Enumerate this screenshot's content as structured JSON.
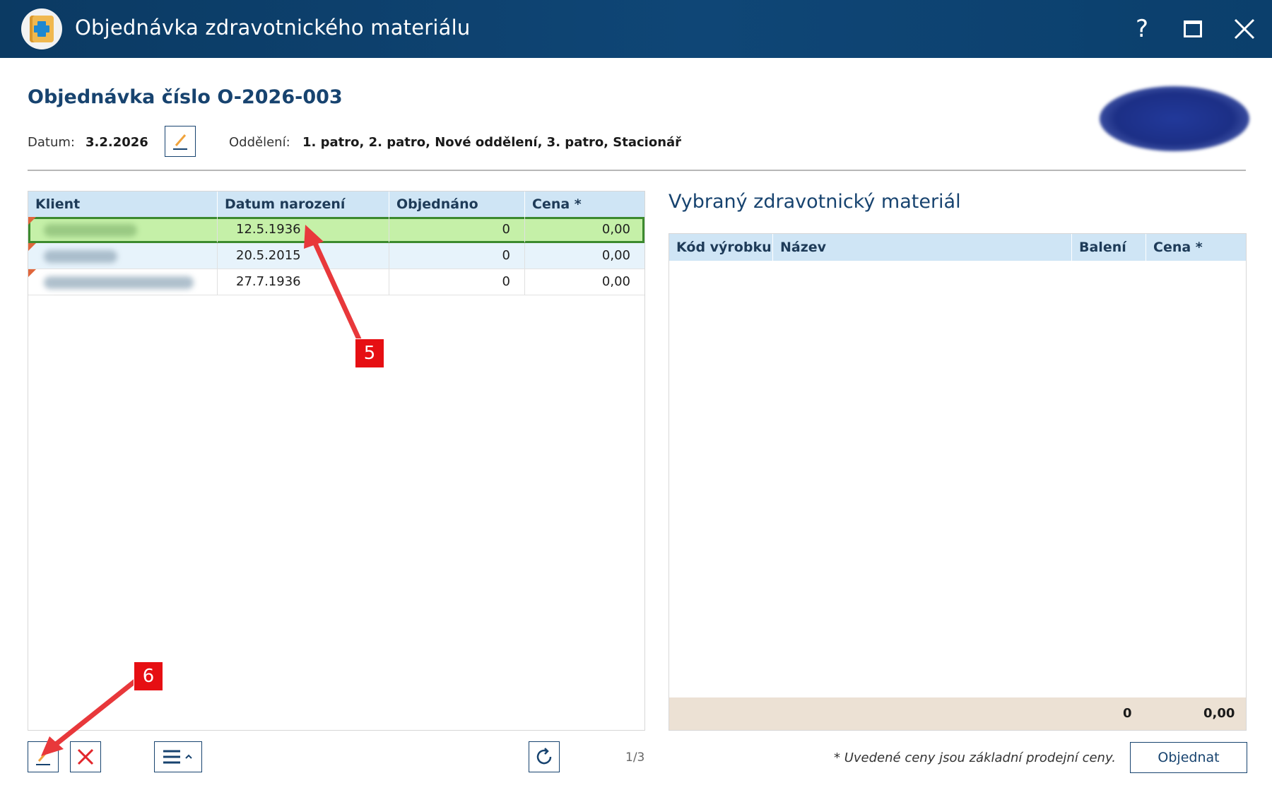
{
  "window": {
    "title": "Objednávka zdravotnického materiálu",
    "help_glyph": "?"
  },
  "header": {
    "order_title": "Objednávka číslo O-2026-003",
    "date_label": "Datum:",
    "date_value": "3.2.2026",
    "dept_label": "Oddělení:",
    "dept_value": "1. patro, 2. patro, Nové oddělení, 3. patro, Stacionář"
  },
  "clients_table": {
    "columns": [
      "Klient",
      "Datum narození",
      "Objednáno",
      "Cena *"
    ],
    "rows": [
      {
        "birth": "12.5.1936",
        "ordered": "0",
        "price": "0,00",
        "selected": true
      },
      {
        "birth": "20.5.2015",
        "ordered": "0",
        "price": "0,00",
        "selected": false
      },
      {
        "birth": "27.7.1936",
        "ordered": "0",
        "price": "0,00",
        "selected": false
      }
    ]
  },
  "materials": {
    "title": "Vybraný zdravotnický materiál",
    "columns": [
      "Kód výrobku",
      "Název",
      "Balení",
      "Cena *"
    ],
    "total_count": "0",
    "total_price": "0,00"
  },
  "footer": {
    "pager": "1/3",
    "note": "* Uvedené ceny jsou základní prodejní ceny.",
    "order_button": "Objednat"
  },
  "annotations": {
    "callout_5": "5",
    "callout_6": "6"
  },
  "colors": {
    "titlebar": "#0f4676",
    "accent": "#17436f",
    "header_row": "#cfe5f5",
    "selected_row": "#c5f0a8",
    "totals_bg": "#ece1d4",
    "callout": "#e60f13"
  }
}
